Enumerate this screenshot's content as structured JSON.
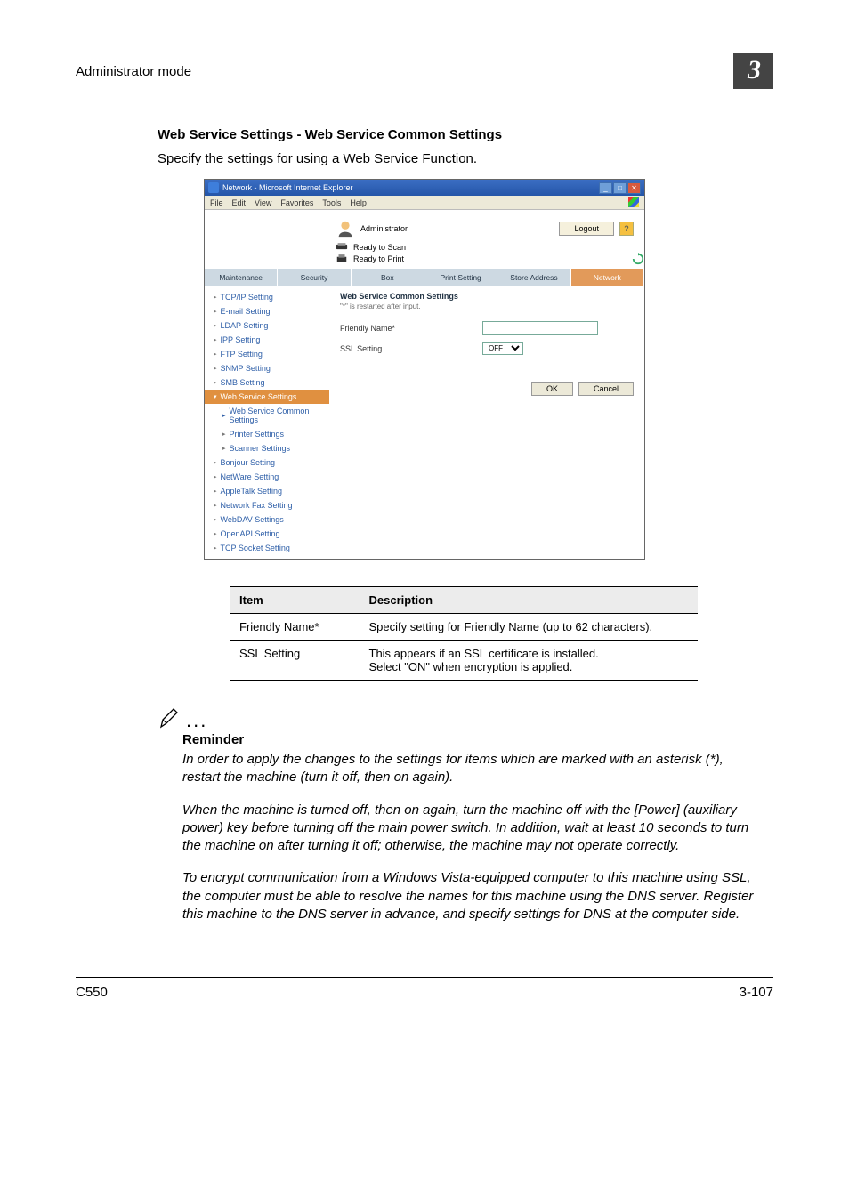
{
  "header": {
    "title": "Administrator mode",
    "chapter": "3"
  },
  "section": {
    "title": "Web Service Settings - Web Service Common Settings",
    "intro": "Specify the settings for using a Web Service Function."
  },
  "screenshot": {
    "window_title": "Network - Microsoft Internet Explorer",
    "menubar": [
      "File",
      "Edit",
      "View",
      "Favorites",
      "Tools",
      "Help"
    ],
    "admin_label": "Administrator",
    "logout": "Logout",
    "status": {
      "scan": "Ready to Scan",
      "print": "Ready to Print"
    },
    "tabs": [
      "Maintenance",
      "Security",
      "Box",
      "Print Setting",
      "Store Address",
      "Network"
    ],
    "active_tab_index": 5,
    "sidebar": {
      "items": [
        "TCP/IP Setting",
        "E-mail Setting",
        "LDAP Setting",
        "IPP Setting",
        "FTP Setting",
        "SNMP Setting",
        "SMB Setting",
        "Web Service Settings",
        "Bonjour Setting",
        "NetWare Setting",
        "AppleTalk Setting",
        "Network Fax Setting",
        "WebDAV Settings",
        "OpenAPI Setting",
        "TCP Socket Setting"
      ],
      "selected_index": 7,
      "sub_items": [
        "Web Service Common Settings",
        "Printer Settings",
        "Scanner Settings"
      ],
      "active_sub_index": 0
    },
    "content": {
      "heading": "Web Service Common Settings",
      "note": "\"*\" is restarted after input.",
      "fields": {
        "friendly_name_label": "Friendly Name*",
        "ssl_label": "SSL Setting",
        "ssl_value": "OFF"
      },
      "buttons": {
        "ok": "OK",
        "cancel": "Cancel"
      }
    }
  },
  "table": {
    "headers": {
      "item": "Item",
      "desc": "Description"
    },
    "rows": [
      {
        "item": "Friendly Name*",
        "desc": "Specify setting for Friendly Name (up to 62 characters)."
      },
      {
        "item": "SSL Setting",
        "desc": "This appears if an SSL certificate is installed.\nSelect \"ON\" when encryption is applied."
      }
    ]
  },
  "reminder": {
    "label": "Reminder",
    "para1": "In order to apply the changes to the settings for items which are marked with an asterisk (*), restart the machine (turn it off, then on again).",
    "para2": "When the machine is turned off, then on again, turn the machine off with the [Power] (auxiliary power) key before turning off the main power switch. In addition, wait at least 10 seconds to turn the machine on after turning it off; otherwise, the machine may not operate correctly.",
    "para3": "To encrypt communication from a Windows Vista-equipped computer to this machine using SSL, the computer must be able to resolve the names for this machine using the DNS server. Register this machine to the DNS server in advance, and specify settings for DNS at the computer side."
  },
  "footer": {
    "left": "C550",
    "right": "3-107"
  }
}
